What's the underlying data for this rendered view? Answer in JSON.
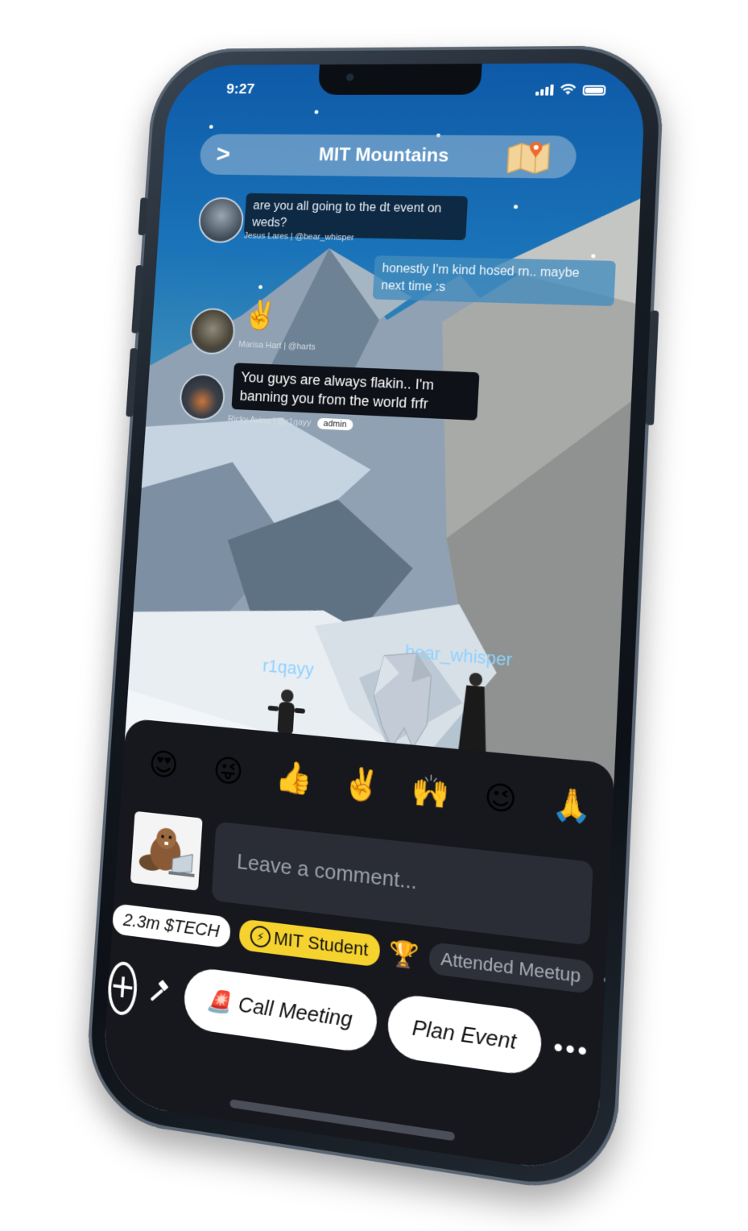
{
  "status_bar": {
    "time": "9:27"
  },
  "room": {
    "title": "MIT Mountains",
    "back_glyph": ">",
    "map_icon": "map-pin-icon"
  },
  "messages": [
    {
      "text": "are you all going to the dt event on weds?",
      "author": "Jesus Lares | @bear_whisper",
      "side": "left"
    },
    {
      "text": "honestly I'm kind hosed rn.. maybe next time :s",
      "side": "right"
    },
    {
      "emoji": "✌️",
      "author": "Marisa Hart | @harts",
      "side": "left"
    },
    {
      "text": "You guys are always flakin.. I'm banning you from the world frfr",
      "author": "Ricky Avina | @r1qayy",
      "badge": "admin",
      "side": "left"
    }
  ],
  "world": {
    "players": [
      "r1qayy",
      "bear_whisper"
    ]
  },
  "reactions": [
    "😍",
    "😜",
    "👍",
    "✌️",
    "🙌",
    "😉",
    "🙏"
  ],
  "composer": {
    "placeholder": "Leave a comment..."
  },
  "badges": {
    "balance": "2.3m $TECH",
    "role": "MIT Student",
    "achievement": "Attended Meetup",
    "more": "•••"
  },
  "actions": {
    "call_meeting": "Call Meeting",
    "call_meeting_emoji": "🚨",
    "plan_event": "Plan Event",
    "more": "•••"
  },
  "colors": {
    "panel_bg": "#16181d",
    "accent_yellow": "#f5d22e",
    "player_label": "#8fd2ff"
  }
}
